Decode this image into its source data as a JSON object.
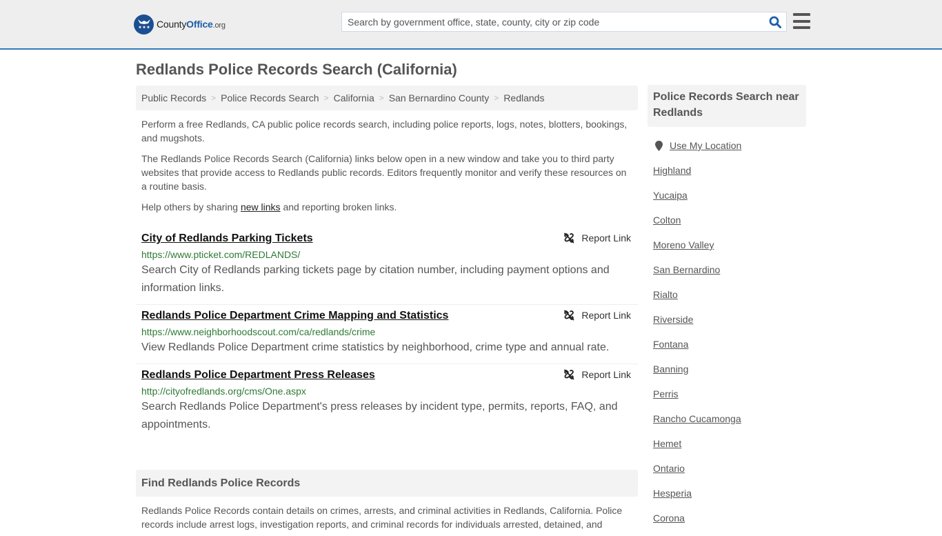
{
  "header": {
    "logo": {
      "name_part1": "County",
      "name_part2": "Office",
      "name_part3": ".org"
    },
    "search": {
      "placeholder": "Search by government office, state, county, city or zip code",
      "value": ""
    },
    "colors": {
      "accent": "#337ab7",
      "logo_blue": "#1c4f91",
      "header_bg": "#eeeeee"
    }
  },
  "page": {
    "title": "Redlands Police Records Search (California)"
  },
  "breadcrumb": [
    {
      "label": "Public Records"
    },
    {
      "label": "Police Records Search"
    },
    {
      "label": "California"
    },
    {
      "label": "San Bernardino County"
    },
    {
      "label": "Redlands"
    }
  ],
  "intro": {
    "p1": "Perform a free Redlands, CA public police records search, including police reports, logs, notes, blotters, bookings, and mugshots.",
    "p2": "The Redlands Police Records Search (California) links below open in a new window and take you to third party websites that provide access to Redlands public records. Editors frequently monitor and verify these resources on a routine basis.",
    "p3_before": "Help others by sharing ",
    "p3_link": "new links",
    "p3_after": " and reporting broken links."
  },
  "links": [
    {
      "title": "City of Redlands Parking Tickets",
      "url": "https://www.pticket.com/REDLANDS/",
      "description": "Search City of Redlands parking tickets page by citation number, including payment options and information links.",
      "report_label": "Report Link"
    },
    {
      "title": "Redlands Police Department Crime Mapping and Statistics",
      "url": "https://www.neighborhoodscout.com/ca/redlands/crime",
      "description": "View Redlands Police Department crime statistics by neighborhood, crime type and annual rate.",
      "report_label": "Report Link"
    },
    {
      "title": "Redlands Police Department Press Releases",
      "url": "http://cityofredlands.org/cms/One.aspx",
      "description": "Search Redlands Police Department's press releases by incident type, permits, reports, FAQ, and appointments.",
      "report_label": "Report Link"
    }
  ],
  "find_section": {
    "heading": "Find Redlands Police Records",
    "text": "Redlands Police Records contain details on crimes, arrests, and criminal activities in Redlands, California. Police records include arrest logs, investigation reports, and criminal records for individuals arrested, detained, and"
  },
  "sidebar": {
    "heading": "Police Records Search near Redlands",
    "use_location": "Use My Location",
    "cities": [
      "Highland",
      "Yucaipa",
      "Colton",
      "Moreno Valley",
      "San Bernardino",
      "Rialto",
      "Riverside",
      "Fontana",
      "Banning",
      "Perris",
      "Rancho Cucamonga",
      "Hemet",
      "Ontario",
      "Hesperia",
      "Corona"
    ]
  }
}
